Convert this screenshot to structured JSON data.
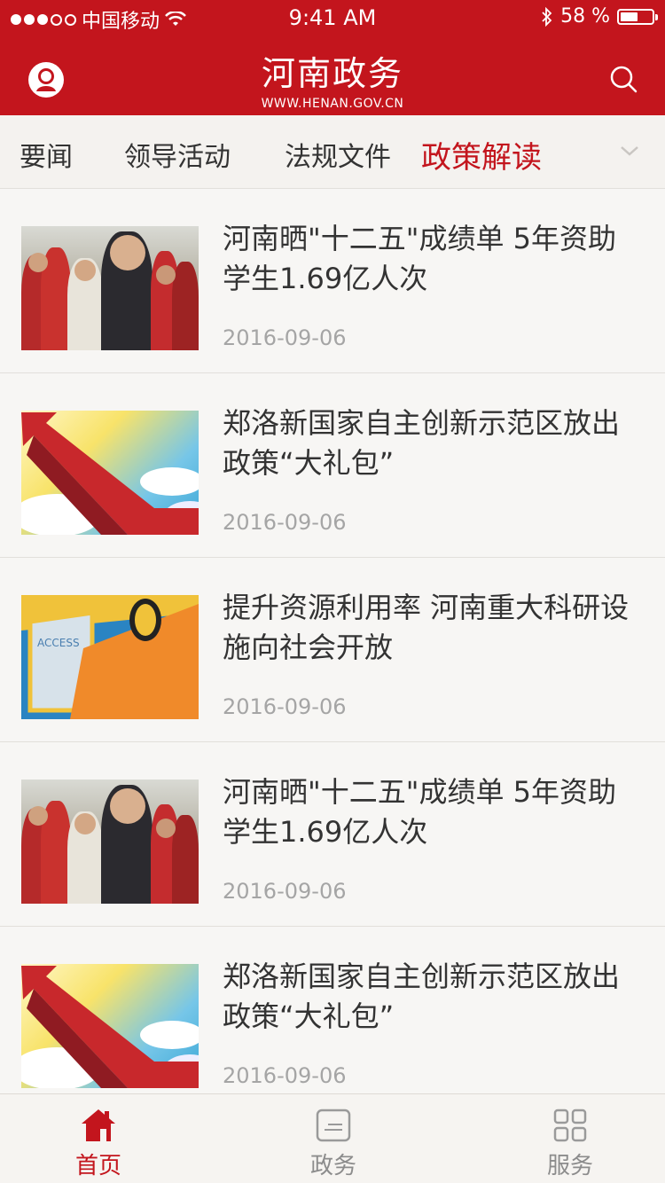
{
  "status_bar": {
    "carrier": "中国移动",
    "time": "9:41 AM",
    "battery": "58 %"
  },
  "header": {
    "title": "河南政务",
    "subtitle": "WWW.HENAN.GOV.CN"
  },
  "tabs": [
    {
      "label": "要闻"
    },
    {
      "label": "领导活动"
    },
    {
      "label": "法规文件"
    },
    {
      "label": "政策解读"
    }
  ],
  "news": [
    {
      "title": "河南晒\"十二五\"成绩单 5年资助学生1.69亿人次",
      "date": "2016-09-06",
      "image": "students-running"
    },
    {
      "title": "郑洛新国家自主创新示范区放出政策“大礼包”",
      "date": "2016-09-06",
      "image": "red-arrow-clouds"
    },
    {
      "title": "提升资源利用率 河南重大科研设施向社会开放",
      "date": "2016-09-06",
      "image": "access-door"
    },
    {
      "title": "河南晒\"十二五\"成绩单 5年资助学生1.69亿人次",
      "date": "2016-09-06",
      "image": "students-running"
    },
    {
      "title": "郑洛新国家自主创新示范区放出政策“大礼包”",
      "date": "2016-09-06",
      "image": "red-arrow-clouds"
    }
  ],
  "tabbar": [
    {
      "label": "首页",
      "icon": "home-icon"
    },
    {
      "label": "政务",
      "icon": "document-icon"
    },
    {
      "label": "服务",
      "icon": "grid-icon"
    }
  ],
  "colors": {
    "brand_red": "#c3151d",
    "muted_text": "#8c8c8c"
  }
}
